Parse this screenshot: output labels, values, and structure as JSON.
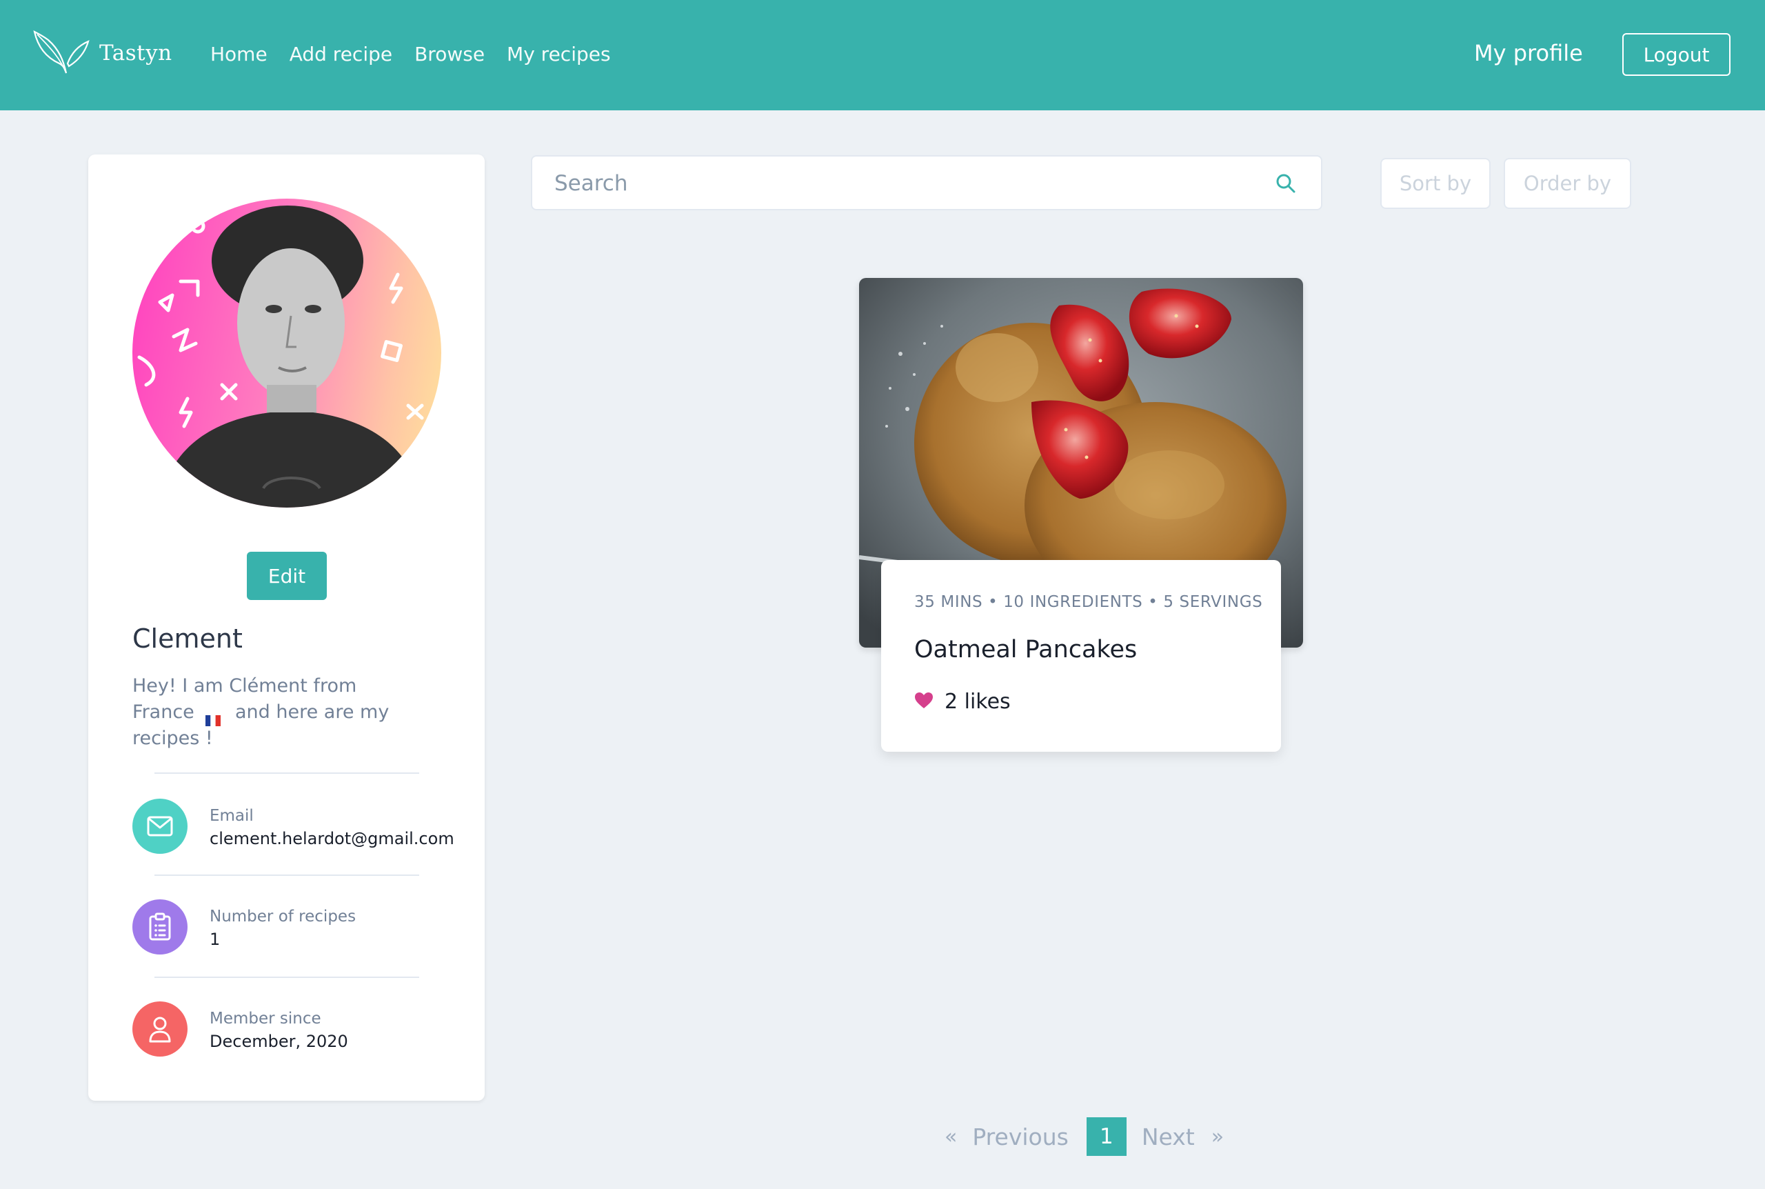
{
  "colors": {
    "brand": "#38b2ac",
    "background": "#edf1f5",
    "email_icon_bg": "#4fd1c5",
    "recipes_icon_bg": "#9f7aea",
    "member_icon_bg": "#f56565",
    "like_heart": "#d53f8c"
  },
  "navbar": {
    "brand_name": "Tastyn",
    "brand_icon": "leaf-icon",
    "links": [
      "Home",
      "Add recipe",
      "Browse",
      "My recipes"
    ],
    "profile_link": "My profile",
    "logout_label": "Logout"
  },
  "profile": {
    "edit_label": "Edit",
    "name": "Clement",
    "bio_before_flag": "Hey! I am Clément from France",
    "bio_after_flag": "and here are my recipes !",
    "flag_icon": "france-flag-icon",
    "email": {
      "label": "Email",
      "value": "clement.helardot@gmail.com",
      "icon": "mail-icon"
    },
    "recipes_count": {
      "label": "Number of recipes",
      "value": "1",
      "icon": "clipboard-list-icon"
    },
    "member_since": {
      "label": "Member since",
      "value": "December, 2020",
      "icon": "user-icon"
    }
  },
  "search": {
    "placeholder": "Search",
    "icon": "search-icon"
  },
  "filters": {
    "sort_label": "Sort by",
    "order_label": "Order by"
  },
  "recipes": [
    {
      "meta": "35 MINS • 10 INGREDIENTS • 5 SERVINGS",
      "title": "Oatmeal Pancakes",
      "likes": "2 likes",
      "like_icon": "heart-icon"
    }
  ],
  "pagination": {
    "first_arrow": "«",
    "previous_label": "Previous",
    "current_page": "1",
    "next_label": "Next",
    "last_arrow": "»"
  }
}
